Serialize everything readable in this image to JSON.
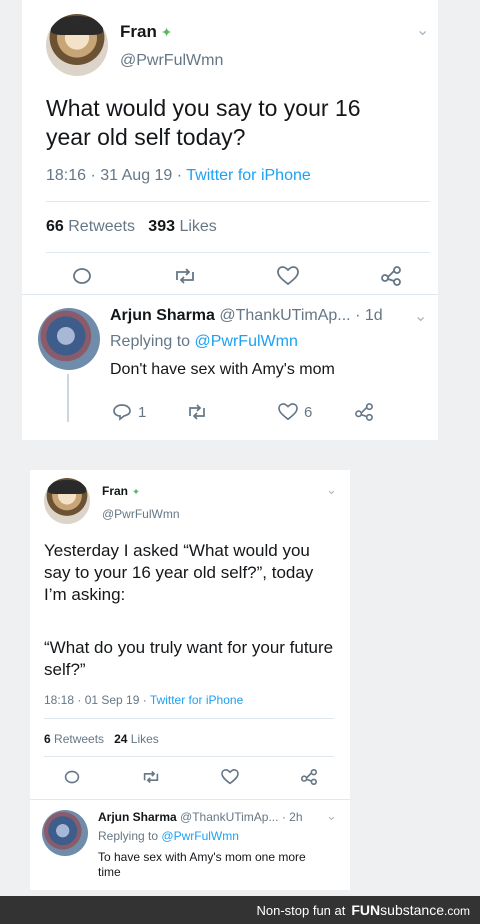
{
  "tweet1": {
    "name": "Fran",
    "handle": "@PwrFulWmn",
    "text": "What would you say to your 16 year old self today?",
    "time": "18:16 · 31 Aug 19 ·",
    "source": "Twitter for iPhone",
    "retweets_count": "66",
    "retweets_label": "Retweets",
    "likes_count": "393",
    "likes_label": "Likes"
  },
  "reply1": {
    "name": "Arjun Sharma",
    "handle": "@ThankUTimAp...",
    "age": "· 1d",
    "replying_label": "Replying to",
    "replying_handle": "@PwrFulWmn",
    "text": "Don't have sex with Amy's mom",
    "reply_count": "1",
    "retweet_count": "",
    "like_count": "6"
  },
  "tweet2": {
    "name": "Fran",
    "handle": "@PwrFulWmn",
    "text1": "Yesterday I asked “What would you say to your 16 year old self?”, today I’m asking:",
    "text2": "“What do you truly want for your future self?”",
    "time": "18:18 · 01 Sep 19 ·",
    "source": "Twitter for iPhone",
    "retweets_count": "6",
    "retweets_label": "Retweets",
    "likes_count": "24",
    "likes_label": "Likes"
  },
  "reply2": {
    "name": "Arjun Sharma",
    "handle": "@ThankUTimAp...",
    "age": "· 2h",
    "replying_label": "Replying to",
    "replying_handle": "@PwrFulWmn",
    "text": "To have sex with Amy's mom one more time"
  },
  "footer": {
    "tagline": "Non-stop fun at",
    "brand_bold": "FUN",
    "brand_rest": "substance",
    "brand_suffix": ".com"
  },
  "icons": [
    "leaf-icon",
    "chevron-down-icon",
    "reply-icon",
    "retweet-icon",
    "like-icon",
    "share-icon"
  ]
}
